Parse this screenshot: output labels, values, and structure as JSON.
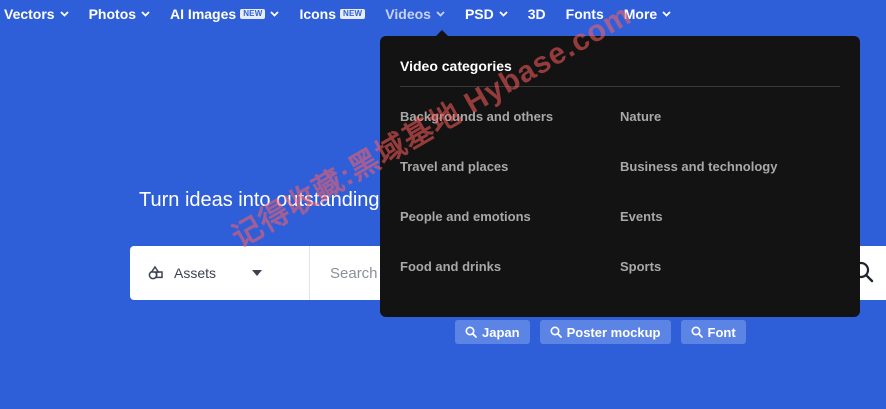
{
  "nav": {
    "items": [
      {
        "label": "Vectors",
        "has_chevron": true
      },
      {
        "label": "Photos",
        "has_chevron": true
      },
      {
        "label": "AI Images",
        "badge": "NEW",
        "has_chevron": true
      },
      {
        "label": "Icons",
        "badge": "NEW",
        "has_chevron": false
      },
      {
        "label": "Videos",
        "has_chevron": true,
        "active": true
      },
      {
        "label": "PSD",
        "has_chevron": true
      },
      {
        "label": "3D",
        "has_chevron": false
      },
      {
        "label": "Fonts",
        "has_chevron": false
      },
      {
        "label": "More",
        "has_chevron": true
      }
    ]
  },
  "hero": {
    "title": "Turn ideas into outstanding designs with high-quality vectors, photos, m"
  },
  "search": {
    "asset_type": "Assets",
    "placeholder": "Search all assets"
  },
  "tags": [
    {
      "label": "Japan"
    },
    {
      "label": "Poster mockup"
    },
    {
      "label": "Font"
    }
  ],
  "dropdown": {
    "title": "Video categories",
    "categories": [
      "Backgrounds and others",
      "Nature",
      "Travel and places",
      "Business and technology",
      "People and emotions",
      "Events",
      "Food and drinks",
      "Sports"
    ]
  },
  "watermark": {
    "text": "记得收藏:黑域基地 Hybase.com"
  },
  "colors": {
    "background": "#2f5fd8",
    "dropdown_bg": "#131313",
    "tag_bg": "#5c84e4",
    "watermark": "#ff5f5f"
  },
  "icons": {
    "chevron": "chevron-down-icon",
    "assets": "assets-icon",
    "search": "search-icon",
    "tag": "search-icon"
  }
}
